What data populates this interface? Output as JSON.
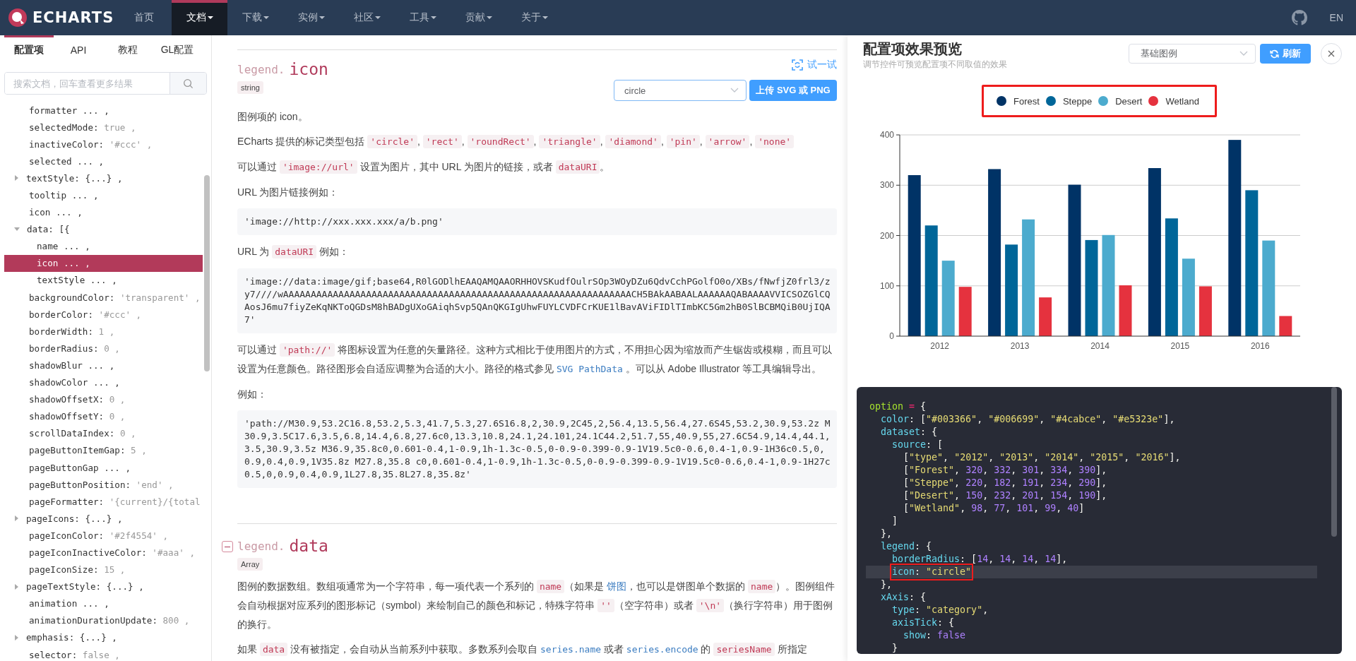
{
  "nav": {
    "logo": "ECHARTS",
    "items": [
      {
        "label": "首页",
        "dropdown": false,
        "selected": false
      },
      {
        "label": "文档",
        "dropdown": true,
        "selected": true
      },
      {
        "label": "下载",
        "dropdown": true,
        "selected": false
      },
      {
        "label": "实例",
        "dropdown": true,
        "selected": false
      },
      {
        "label": "社区",
        "dropdown": true,
        "selected": false
      },
      {
        "label": "工具",
        "dropdown": true,
        "selected": false
      },
      {
        "label": "贡献",
        "dropdown": true,
        "selected": false
      },
      {
        "label": "关于",
        "dropdown": true,
        "selected": false
      }
    ],
    "language": "EN"
  },
  "sidebar": {
    "tabs": [
      {
        "label": "配置项",
        "selected": true
      },
      {
        "label": "API",
        "selected": false
      },
      {
        "label": "教程",
        "selected": false
      },
      {
        "label": "GL配置",
        "selected": false
      }
    ],
    "search": {
      "placeholder": "搜索文档，回车查看更多结果"
    },
    "tree": [
      {
        "kind": "leaf",
        "label": "formatter ... ,",
        "selected": false
      },
      {
        "kind": "leaf",
        "label": "selectedMode:",
        "value": "true ,",
        "selected": false
      },
      {
        "kind": "leaf",
        "label": "inactiveColor:",
        "value": "'#ccc' ,",
        "selected": false
      },
      {
        "kind": "leaf",
        "label": "selected ... ,",
        "selected": false
      },
      {
        "kind": "group",
        "label": "textStyle: {...} ,",
        "expanded": false,
        "selected": false
      },
      {
        "kind": "leaf",
        "label": "tooltip ... ,",
        "selected": false
      },
      {
        "kind": "leaf",
        "label": "icon ... ,",
        "selected": false
      },
      {
        "kind": "group",
        "label": "data: [{",
        "expanded": true,
        "selected": false,
        "children": [
          {
            "kind": "leaf",
            "label": "name ... ,",
            "selected": false
          },
          {
            "kind": "leaf",
            "label": "icon ... ,",
            "selected": true
          },
          {
            "kind": "leaf",
            "label": "textStyle ... ,",
            "selected": false
          }
        ]
      },
      {
        "kind": "leaf",
        "label": "backgroundColor:",
        "value": "'transparent' ,",
        "selected": false
      },
      {
        "kind": "leaf",
        "label": "borderColor:",
        "value": "'#ccc' ,",
        "selected": false
      },
      {
        "kind": "leaf",
        "label": "borderWidth:",
        "value": "1 ,",
        "selected": false
      },
      {
        "kind": "leaf",
        "label": "borderRadius:",
        "value": "0 ,",
        "selected": false
      },
      {
        "kind": "leaf",
        "label": "shadowBlur ... ,",
        "selected": false
      },
      {
        "kind": "leaf",
        "label": "shadowColor ... ,",
        "selected": false
      },
      {
        "kind": "leaf",
        "label": "shadowOffsetX:",
        "value": "0 ,",
        "selected": false
      },
      {
        "kind": "leaf",
        "label": "shadowOffsetY:",
        "value": "0 ,",
        "selected": false
      },
      {
        "kind": "leaf",
        "label": "scrollDataIndex:",
        "value": "0 ,",
        "selected": false
      },
      {
        "kind": "leaf",
        "label": "pageButtonItemGap:",
        "value": "5 ,",
        "selected": false
      },
      {
        "kind": "leaf",
        "label": "pageButtonGap ... ,",
        "selected": false
      },
      {
        "kind": "leaf",
        "label": "pageButtonPosition:",
        "value": "'end' ,",
        "selected": false
      },
      {
        "kind": "leaf",
        "label": "pageFormatter:",
        "value": "'{current}/{total",
        "selected": false
      },
      {
        "kind": "group",
        "label": "pageIcons: {...} ,",
        "expanded": false,
        "selected": false
      },
      {
        "kind": "leaf",
        "label": "pageIconColor:",
        "value": "'#2f4554' ,",
        "selected": false
      },
      {
        "kind": "leaf",
        "label": "pageIconInactiveColor:",
        "value": "'#aaa' ,",
        "selected": false
      },
      {
        "kind": "leaf",
        "label": "pageIconSize:",
        "value": "15 ,",
        "selected": false
      },
      {
        "kind": "group",
        "label": "pageTextStyle: {...} ,",
        "expanded": false,
        "selected": false
      },
      {
        "kind": "leaf",
        "label": "animation ... ,",
        "selected": false
      },
      {
        "kind": "leaf",
        "label": "animationDurationUpdate:",
        "value": "800 ,",
        "selected": false
      },
      {
        "kind": "group",
        "label": "emphasis: {...} ,",
        "expanded": false,
        "selected": false
      },
      {
        "kind": "leaf",
        "label": "selector:",
        "value": "false ,",
        "selected": false
      }
    ]
  },
  "doc": {
    "sections": [
      {
        "path": "legend.",
        "name": "icon",
        "type": "string",
        "show_toggle": false,
        "try_link": "试一试",
        "select_value": "circle",
        "upload_button": "上传 SVG 或 PNG",
        "blocks": [
          {
            "kind": "paragraph",
            "segments": [
              {
                "kind": "text",
                "text": "图例项的 icon。"
              }
            ]
          },
          {
            "kind": "paragraph",
            "segments": [
              {
                "kind": "text",
                "text": "ECharts 提供的标记类型包括 "
              },
              {
                "kind": "code",
                "text": "'circle'"
              },
              {
                "kind": "text",
                "text": ", "
              },
              {
                "kind": "code",
                "text": "'rect'"
              },
              {
                "kind": "text",
                "text": ", "
              },
              {
                "kind": "code",
                "text": "'roundRect'"
              },
              {
                "kind": "text",
                "text": ", "
              },
              {
                "kind": "code",
                "text": "'triangle'"
              },
              {
                "kind": "text",
                "text": ", "
              },
              {
                "kind": "code",
                "text": "'diamond'"
              },
              {
                "kind": "text",
                "text": ", "
              },
              {
                "kind": "code",
                "text": "'pin'"
              },
              {
                "kind": "text",
                "text": ", "
              },
              {
                "kind": "code",
                "text": "'arrow'"
              },
              {
                "kind": "text",
                "text": ", "
              },
              {
                "kind": "code",
                "text": "'none'"
              }
            ]
          },
          {
            "kind": "paragraph",
            "segments": [
              {
                "kind": "text",
                "text": "可以通过 "
              },
              {
                "kind": "code",
                "text": "'image://url'"
              },
              {
                "kind": "text",
                "text": " 设置为图片，其中 URL 为图片的链接，或者 "
              },
              {
                "kind": "code",
                "text": "dataURI"
              },
              {
                "kind": "text",
                "text": "。"
              }
            ]
          },
          {
            "kind": "paragraph",
            "segments": [
              {
                "kind": "text",
                "text": "URL 为图片链接例如："
              }
            ]
          },
          {
            "kind": "code_block",
            "text": "'image://http://xxx.xxx.xxx/a/b.png'"
          },
          {
            "kind": "paragraph",
            "segments": [
              {
                "kind": "text",
                "text": "URL 为 "
              },
              {
                "kind": "code",
                "text": "dataURI"
              },
              {
                "kind": "text",
                "text": " 例如："
              }
            ]
          },
          {
            "kind": "code_block",
            "text": "'image://data:image/gif;base64,R0lGODlhEAAQAMQAAORHHOVSKudfOulrSOp3WOyDZu6QdvCchPGolfO0o/XBs/fNwfjZ0frl3/zy7////wAAAAAAAAAAAAAAAAAAAAAAAAAAAAAAAAAAAAAAAAAAAAAAAAAAAAAAAAAAAAAAACH5BAkAABAALAAAAAAQABAAAAVVICSOZGlCQAosJ6mu7fiyZeKqNKToQGDsM8hBADgUXoGAiqhSvp5QAnQKGIgUhwFUYLCVDFCrKUE1lBavAViFIDlTImbKC5Gm2hB0SlBCBMQiB0UjIQA7'"
          },
          {
            "kind": "paragraph",
            "segments": [
              {
                "kind": "text",
                "text": "可以通过 "
              },
              {
                "kind": "code",
                "text": "'path://'"
              },
              {
                "kind": "text",
                "text": " 将图标设置为任意的矢量路径。这种方式相比于使用图片的方式，不用担心因为缩放而产生锯齿或模糊，而且可以设置为任意颜色。路径图形会自适应调整为合适的大小。路径的格式参见 "
              },
              {
                "kind": "code_link",
                "text": "SVG PathData"
              },
              {
                "kind": "text",
                "text": " 。可以从 Adobe Illustrator 等工具编辑导出。"
              }
            ]
          },
          {
            "kind": "paragraph",
            "segments": [
              {
                "kind": "text",
                "text": "例如："
              }
            ]
          },
          {
            "kind": "code_block",
            "text": "'path://M30.9,53.2C16.8,53.2,5.3,41.7,5.3,27.6S16.8,2,30.9,2C45,2,56.4,13.5,56.4,27.6S45,53.2,30.9,53.2z M30.9,3.5C17.6,3.5,6.8,14.4,6.8,27.6c0,13.3,10.8,24.1,24.101,24.1C44.2,51.7,55,40.9,55,27.6C54.9,14.4,44.1,3.5,30.9,3.5z M36.9,35.8c0,0.601-0.4,1-0.9,1h-1.3c-0.5,0-0.9-0.399-0.9-1V19.5c0-0.6,0.4-1,0.9-1H36c0.5,0,0.9,0.4,0.9,1V35.8z M27.8,35.8 c0,0.601-0.4,1-0.9,1h-1.3c-0.5,0-0.9-0.399-0.9-1V19.5c0-0.6,0.4-1,0.9-1H27c0.5,0,0.9,0.4,0.9,1L27.8,35.8L27.8,35.8z'"
          }
        ]
      },
      {
        "path": "legend.",
        "name": "data",
        "type": "Array",
        "show_toggle": true,
        "blocks": [
          {
            "kind": "paragraph",
            "segments": [
              {
                "kind": "text",
                "text": "图例的数据数组。数组项通常为一个字符串，每一项代表一个系列的 "
              },
              {
                "kind": "code",
                "text": "name"
              },
              {
                "kind": "text",
                "text": "（如果是 "
              },
              {
                "kind": "link",
                "text": "饼图"
              },
              {
                "kind": "text",
                "text": "，也可以是饼图单个数据的 "
              },
              {
                "kind": "code",
                "text": "name"
              },
              {
                "kind": "text",
                "text": "）。图例组件会自动根据对应系列的图形标记（symbol）来绘制自己的颜色和标记，特殊字符串 "
              },
              {
                "kind": "code",
                "text": "''"
              },
              {
                "kind": "text",
                "text": "（空字符串）或者 "
              },
              {
                "kind": "code",
                "text": "'\\n'"
              },
              {
                "kind": "text",
                "text": "（换行字符串）用于图例的换行。"
              }
            ]
          },
          {
            "kind": "paragraph",
            "segments": [
              {
                "kind": "text",
                "text": "如果 "
              },
              {
                "kind": "code",
                "text": "data"
              },
              {
                "kind": "text",
                "text": " 没有被指定，会自动从当前系列中获取。多数系列会取自 "
              },
              {
                "kind": "code_link",
                "text": "series.name"
              },
              {
                "kind": "text",
                "text": " 或者 "
              },
              {
                "kind": "code_link",
                "text": "series.encode"
              },
              {
                "kind": "text",
                "text": " 的 "
              },
              {
                "kind": "code",
                "text": "seriesName"
              },
              {
                "kind": "text",
                "text": " 所指定"
              }
            ]
          }
        ]
      }
    ]
  },
  "preview": {
    "title": "配置项效果预览",
    "subtitle": "调节控件可预览配置项不同取值的效果",
    "example_select": "基础图例",
    "refresh_button": "刷新",
    "legend_outlined": true,
    "chart_data": {
      "type": "bar",
      "categories": [
        "2012",
        "2013",
        "2014",
        "2015",
        "2016"
      ],
      "series": [
        {
          "name": "Forest",
          "color": "#003366",
          "values": [
            320,
            332,
            301,
            334,
            390
          ]
        },
        {
          "name": "Steppe",
          "color": "#006699",
          "values": [
            220,
            182,
            191,
            234,
            290
          ]
        },
        {
          "name": "Desert",
          "color": "#4cabce",
          "values": [
            150,
            232,
            201,
            154,
            190
          ]
        },
        {
          "name": "Wetland",
          "color": "#e5323e",
          "values": [
            98,
            77,
            101,
            99,
            40
          ]
        }
      ],
      "ylim": [
        0,
        400
      ],
      "yticks": [
        0,
        100,
        200,
        300,
        400
      ],
      "grid": true,
      "legend": "top"
    },
    "code": {
      "lines": [
        {
          "text": "option = {",
          "highlighted": false
        },
        {
          "text": "  color: [\"#003366\", \"#006699\", \"#4cabce\", \"#e5323e\"],",
          "highlighted": false
        },
        {
          "text": "  dataset: {",
          "highlighted": false
        },
        {
          "text": "    source: [",
          "highlighted": false
        },
        {
          "text": "      [\"type\", \"2012\", \"2013\", \"2014\", \"2015\", \"2016\"],",
          "highlighted": false
        },
        {
          "text": "      [\"Forest\", 320, 332, 301, 334, 390],",
          "highlighted": false
        },
        {
          "text": "      [\"Steppe\", 220, 182, 191, 234, 290],",
          "highlighted": false
        },
        {
          "text": "      [\"Desert\", 150, 232, 201, 154, 190],",
          "highlighted": false
        },
        {
          "text": "      [\"Wetland\", 98, 77, 101, 99, 40]",
          "highlighted": false
        },
        {
          "text": "    ]",
          "highlighted": false
        },
        {
          "text": "  },",
          "highlighted": false
        },
        {
          "text": "  legend: {",
          "highlighted": false
        },
        {
          "text": "    borderRadius: [14, 14, 14, 14],",
          "highlighted": false
        },
        {
          "text": "    icon: \"circle\"",
          "highlighted": true
        },
        {
          "text": "  },",
          "highlighted": false
        },
        {
          "text": "  xAxis: {",
          "highlighted": false
        },
        {
          "text": "    type: \"category\",",
          "highlighted": false
        },
        {
          "text": "    axisTick: {",
          "highlighted": false
        },
        {
          "text": "      show: false",
          "highlighted": false
        },
        {
          "text": "    }",
          "highlighted": false
        }
      ]
    }
  }
}
